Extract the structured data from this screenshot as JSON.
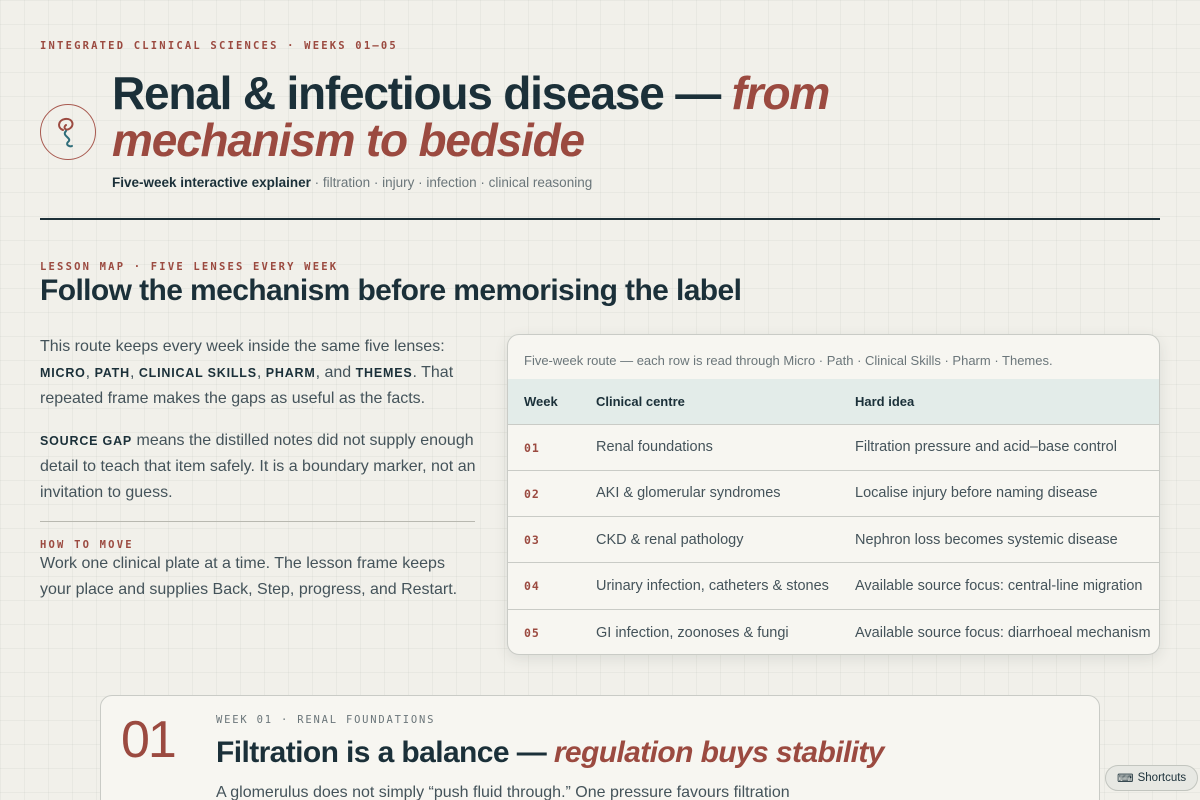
{
  "header": {
    "eyebrow": "INTEGRATED CLINICAL SCIENCES · WEEKS 01–05",
    "title_main": "Renal & infectious disease — ",
    "title_accent": "from mechanism to bedside",
    "subtitle_bold": "Five-week interactive explainer",
    "subtitle_rest": " · filtration · injury · infection · clinical reasoning",
    "logo_icon": "kidney-swirl-icon"
  },
  "lesson_map": {
    "eyebrow": "LESSON MAP · FIVE LENSES EVERY WEEK",
    "heading": "Follow the mechanism before memorising the label",
    "intro_start": "This route keeps every week inside the same five lenses: ",
    "lens_micro": "MICRO",
    "lens_path": "PATH",
    "lens_clinical": "CLINICAL SKILLS",
    "lens_pharm": "PHARM",
    "lens_themes": "THEMES",
    "sep_comma": ", ",
    "sep_and": ", and ",
    "intro_end": ". That repeated frame makes the gaps as useful as the facts.",
    "source_gap_label": "SOURCE GAP",
    "source_gap_text": " means the distilled notes did not supply enough detail to teach that item safely. It is a boundary marker, not an invitation to guess.",
    "howto_label": "HOW TO MOVE",
    "howto_text": "Work one clinical plate at a time. The lesson frame keeps your place and supplies Back, Step, progress, and Restart."
  },
  "route_table": {
    "caption": "Five-week route — each row is read through Micro · Path · Clinical Skills · Pharm · Themes.",
    "headers": [
      "Week",
      "Clinical centre",
      "Hard idea"
    ],
    "rows": [
      {
        "week": "01",
        "centre": "Renal foundations",
        "idea": "Filtration pressure and acid–base control"
      },
      {
        "week": "02",
        "centre": "AKI & glomerular syndromes",
        "idea": "Localise injury before naming disease"
      },
      {
        "week": "03",
        "centre": "CKD & renal pathology",
        "idea": "Nephron loss becomes systemic disease"
      },
      {
        "week": "04",
        "centre": "Urinary infection, catheters & stones",
        "idea": "Available source focus: central-line migration"
      },
      {
        "week": "05",
        "centre": "GI infection, zoonoses & fungi",
        "idea": "Available source focus: diarrhoeal mechanism"
      }
    ]
  },
  "week_card": {
    "number": "01",
    "eyebrow": "WEEK 01 · RENAL FOUNDATIONS",
    "title_main": "Filtration is a balance — ",
    "title_accent": "regulation buys stability",
    "body": "A glomerulus does not simply “push fluid through.” One pressure favours filtration"
  },
  "shortcuts": {
    "icon": "keyboard-icon",
    "label": "Shortcuts"
  }
}
